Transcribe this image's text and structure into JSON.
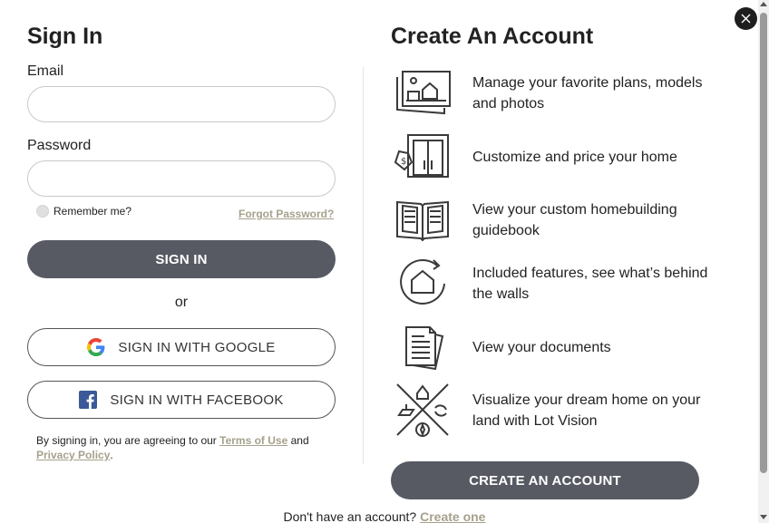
{
  "signin": {
    "title": "Sign In",
    "email_label": "Email",
    "email_value": "",
    "email_placeholder": "",
    "password_label": "Password",
    "password_value": "",
    "password_placeholder": "",
    "remember_label": "Remember me?",
    "forgot_label": "Forgot Password?",
    "submit_label": "SIGN IN",
    "or_text": "or",
    "google_label": "SIGN IN WITH GOOGLE",
    "facebook_label": "SIGN IN WITH FACEBOOK",
    "terms_prefix": "By signing in, you are agreeing to our ",
    "terms_link": "Terms of Use",
    "terms_and": " and",
    "privacy_link": "Privacy Policy",
    "terms_suffix": "."
  },
  "create": {
    "title": "Create An Account",
    "features": [
      {
        "icon": "photos-icon",
        "text": "Manage your favorite plans, models and photos"
      },
      {
        "icon": "price-tag-door-icon",
        "text": "Customize and price your home"
      },
      {
        "icon": "guidebook-icon",
        "text": "View your custom homebuilding guidebook"
      },
      {
        "icon": "house-rotate-icon",
        "text": "Included features, see what’s behind the walls"
      },
      {
        "icon": "documents-icon",
        "text": "View your documents"
      },
      {
        "icon": "lot-vision-icon",
        "text": "Visualize your dream home on your land with Lot Vision"
      }
    ],
    "button_label": "CREATE AN ACCOUNT"
  },
  "footer": {
    "prompt": "Don't have an account? ",
    "link": "Create one"
  },
  "colors": {
    "primary_button": "#575963",
    "link": "#a6a18c",
    "close_button": "#1e1e1e"
  }
}
